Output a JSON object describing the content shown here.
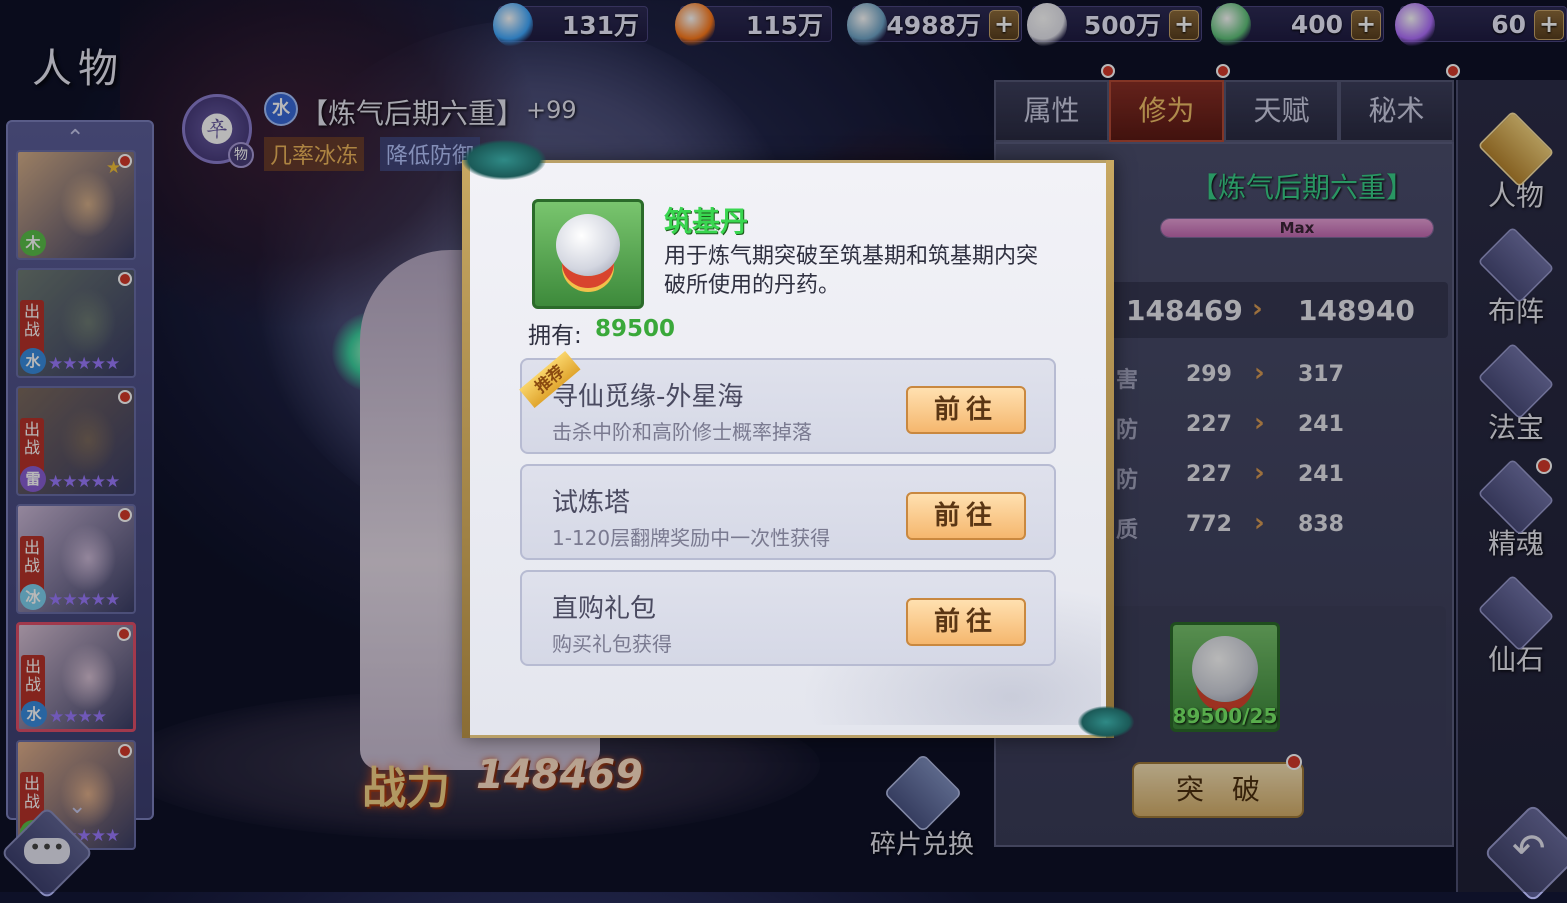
{
  "resources": [
    {
      "name": "spirit-water",
      "value": "131万",
      "color": "#3fa8ff",
      "plus": false
    },
    {
      "name": "flame",
      "value": "115万",
      "color": "#ff7a1a",
      "plus": false
    },
    {
      "name": "pouch",
      "value": "4988万",
      "color": "#6fa5c8",
      "plus": true
    },
    {
      "name": "ingot",
      "value": "500万",
      "color": "#e6e6ee",
      "plus": true
    },
    {
      "name": "crystal-gem",
      "value": "400",
      "color": "#5fc37a",
      "plus": true
    },
    {
      "name": "rainbow-gem",
      "value": "60",
      "color": "#b06fff",
      "plus": true
    }
  ],
  "header": {
    "title": "人物",
    "element_char": "水",
    "hero_name": "【炼气后期六重】",
    "hero_bonus": "+99",
    "skill_tags": [
      "几率冰冻",
      "降低防御"
    ],
    "weapon_badge": "物"
  },
  "hero_list": [
    {
      "element": "木",
      "element_color": "#5bbf4a",
      "deploy": "",
      "star_count": 1,
      "dot": true,
      "selected": false,
      "tone": "#d7b08a"
    },
    {
      "element": "水",
      "element_color": "#3a8de0",
      "deploy": "出战",
      "star_count": 5,
      "dot": true,
      "selected": false,
      "tone": "#6f7c74"
    },
    {
      "element": "雷",
      "element_color": "#8a5fd4",
      "deploy": "出战",
      "star_count": 5,
      "dot": true,
      "selected": false,
      "tone": "#7c6a5e"
    },
    {
      "element": "冰",
      "element_color": "#7fd2f0",
      "deploy": "出战",
      "star_count": 5,
      "dot": true,
      "selected": false,
      "tone": "#cdbad8"
    },
    {
      "element": "水",
      "element_color": "#3a8de0",
      "deploy": "出战",
      "star_count": 4,
      "dot": true,
      "selected": true,
      "tone": "#d9c2d6"
    },
    {
      "element": "木",
      "element_color": "#5bbf4a",
      "deploy": "出战",
      "star_count": 5,
      "dot": true,
      "selected": false,
      "tone": "#e2b08b"
    }
  ],
  "tabs": [
    {
      "label": "属性",
      "active": false,
      "dot": true
    },
    {
      "label": "修为",
      "active": true,
      "dot": true
    },
    {
      "label": "天赋",
      "active": false,
      "dot": false
    },
    {
      "label": "秘术",
      "active": false,
      "dot": true
    }
  ],
  "realm": {
    "title": "【炼气后期六重】",
    "bar_label": "Max",
    "progress": 1.0
  },
  "power_change": {
    "from": "148469",
    "to": "148940"
  },
  "stat_rows": [
    {
      "label": "害",
      "from": "299",
      "to": "317"
    },
    {
      "label": "防",
      "from": "227",
      "to": "241"
    },
    {
      "label": "防",
      "from": "227",
      "to": "241"
    },
    {
      "label": "质",
      "from": "772",
      "to": "838"
    }
  ],
  "breakthrough": {
    "count_label": "89500/25",
    "button_label": "突　破"
  },
  "side_menu": [
    "人物",
    "布阵",
    "法宝",
    "精魂",
    "仙石"
  ],
  "power": {
    "label": "战力",
    "value": "148469"
  },
  "shard_exchange": "碎片兑换",
  "popup": {
    "item_name": "筑基丹",
    "item_desc": "用于炼气期突破至筑基期和筑基期内突破所使用的丹药。",
    "owned_label": "拥有:",
    "owned_value": "89500",
    "ribbon": "推荐",
    "sources": [
      {
        "name": "寻仙觅缘-外星海",
        "desc": "击杀中阶和高阶修士概率掉落",
        "button": "前往"
      },
      {
        "name": "试炼塔",
        "desc": "1-120层翻牌奖励中一次性获得",
        "button": "前往"
      },
      {
        "name": "直购礼包",
        "desc": "购买礼包获得",
        "button": "前往"
      }
    ]
  },
  "chat_icon": "chat-bubble-icon",
  "back_icon": "back-arrow-icon"
}
